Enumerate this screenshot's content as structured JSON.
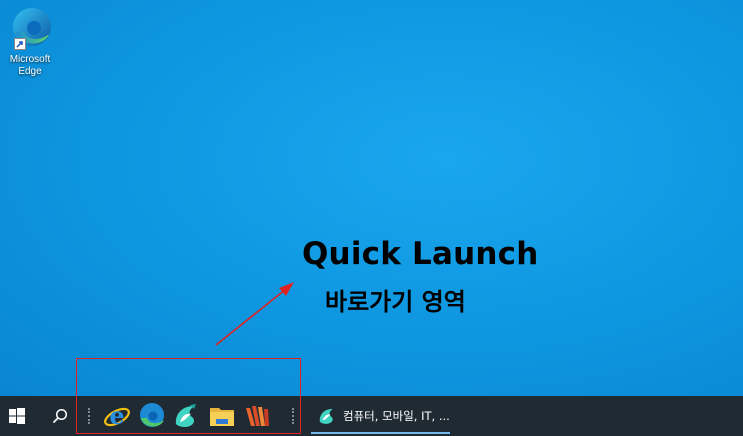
{
  "desktop": {
    "icons": [
      {
        "label": "Microsoft Edge",
        "icon": "edge-icon"
      }
    ]
  },
  "annotation": {
    "title": "Quick Launch",
    "subtitle": "바로가기 영역",
    "arrow_color": "#e02222",
    "box_color": "#e02222"
  },
  "taskbar": {
    "start_icon": "windows-logo-icon",
    "search_icon": "search-icon",
    "quick_launch": [
      {
        "name": "Internet Explorer",
        "icon": "internet-explorer-icon"
      },
      {
        "name": "Microsoft Edge",
        "icon": "edge-icon"
      },
      {
        "name": "Whale",
        "icon": "whale-icon"
      },
      {
        "name": "File Explorer",
        "icon": "file-explorer-icon"
      },
      {
        "name": "App",
        "icon": "stripes-app-icon"
      }
    ],
    "task": {
      "icon": "whale-icon",
      "label": "컴퓨터, 모바일, IT, ..."
    },
    "accent": "#76b9ed"
  }
}
